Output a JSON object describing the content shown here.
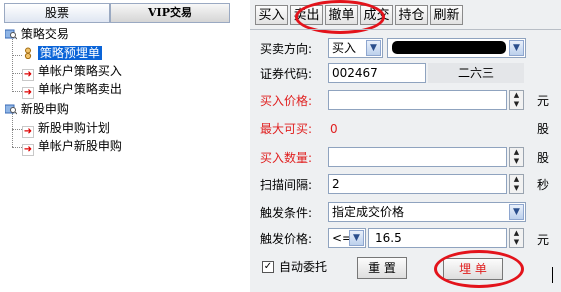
{
  "tabs": {
    "stocks": "股票",
    "vip": "VIP交易"
  },
  "tree": {
    "strategy": "策略交易",
    "pre_order": "策略预埋单",
    "single_buy": "单帐户策略买入",
    "single_sell": "单帐户策略卖出",
    "ipo": "新股申购",
    "ipo_plan": "新股申购计划",
    "single_ipo": "单帐户新股申购"
  },
  "toolbar": [
    "买入",
    "卖出",
    "撤单",
    "成交",
    "持仓",
    "刷新"
  ],
  "form": {
    "direction_label": "买卖方向:",
    "direction_value": "买入",
    "code_label": "证券代码:",
    "code_value": "002467",
    "stock_name": "二六三",
    "price_label": "买入价格:",
    "price_value": "",
    "price_unit": "元",
    "maxbuy_label": "最大可买:",
    "maxbuy_value": "0",
    "maxbuy_unit": "股",
    "qty_label": "买入数量:",
    "qty_value": "",
    "qty_unit": "股",
    "interval_label": "扫描间隔:",
    "interval_value": "2",
    "interval_unit": "秒",
    "cond_label": "触发条件:",
    "cond_value": "指定成交价格",
    "trig_label": "触发价格:",
    "trig_op": "<=",
    "trig_value": "16.5",
    "trig_unit": "元",
    "auto_label": "自动委托",
    "reset_label": "重 置",
    "submit_label": "埋 单"
  },
  "colors": {
    "annotation": "#e3131b",
    "selected": "#0a64d8",
    "red_label": "#e02020"
  }
}
